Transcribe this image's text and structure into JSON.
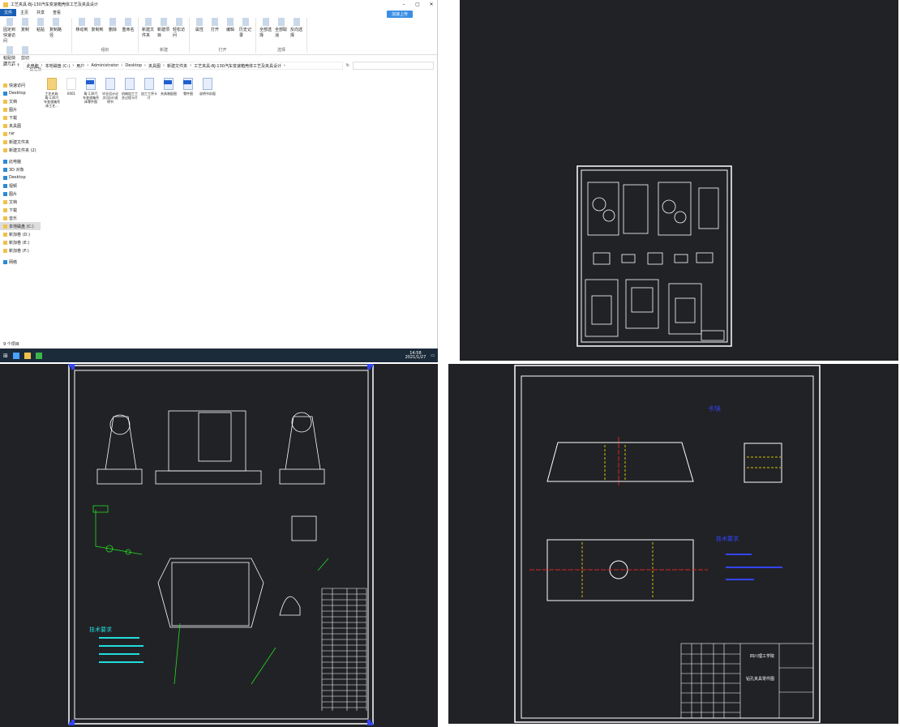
{
  "explorer": {
    "title": "工艺夹具-BJ-130汽车变速箱壳体工艺及夹具设计",
    "tabs": [
      "文件",
      "主页",
      "共享",
      "查看"
    ],
    "upload_label": "加速上传",
    "ribbon": [
      {
        "group": "剪贴板",
        "buttons": [
          "固定到快速访问",
          "复制",
          "粘贴",
          "复制路径",
          "粘贴快捷方式",
          "剪切"
        ]
      },
      {
        "group": "组织",
        "buttons": [
          "移动到",
          "复制到",
          "删除",
          "重命名"
        ]
      },
      {
        "group": "新建",
        "buttons": [
          "新建文件夹",
          "新建项目",
          "轻松访问"
        ]
      },
      {
        "group": "打开",
        "buttons": [
          "属性",
          "打开",
          "编辑",
          "历史记录"
        ]
      },
      {
        "group": "选择",
        "buttons": [
          "全部选择",
          "全部取消",
          "反向选择"
        ]
      }
    ],
    "breadcrumb": [
      "此电脑",
      "本地磁盘 (C:)",
      "用户",
      "Administrator",
      "Desktop",
      "夹具图",
      "新建文件夹",
      "工艺夹具-BJ-130汽车变速箱壳体工艺及夹具设计"
    ],
    "nav": [
      "快速访问",
      "Desktop",
      "文档",
      "图片",
      "下载",
      "夹具图",
      "rar",
      "新建文件夹",
      "新建文件夹 (2)",
      "此电脑",
      "3D 对象",
      "Desktop",
      "视频",
      "图片",
      "文档",
      "下载",
      "音乐",
      "本地磁盘 (C:)",
      "新加卷 (D:)",
      "新加卷 (E:)",
      "新加卷 (F:)",
      "网络"
    ],
    "files": [
      {
        "name": "工艺夹具-BJ-130汽车变速箱壳体工艺...",
        "type": "folder"
      },
      {
        "name": "0001",
        "type": "blank"
      },
      {
        "name": "BJ-130汽车变速箱壳体零件图",
        "type": "dwg"
      },
      {
        "name": "毕业设计论文(设计)说明书",
        "type": "doc"
      },
      {
        "name": "机械加工工艺过程卡片",
        "type": "doc"
      },
      {
        "name": "加工工序卡片",
        "type": "doc"
      },
      {
        "name": "夹具装配图",
        "type": "dwg"
      },
      {
        "name": "零件图",
        "type": "dwg"
      },
      {
        "name": "说明书封面",
        "type": "doc"
      }
    ],
    "status": "9 个项目"
  },
  "taskbar": {
    "time": "14:58",
    "date": "2021/1/27"
  },
  "cad": {
    "assembly_notes_title": "技术要求",
    "part_title": "卡块",
    "part_notes_title": "技术要求",
    "school": "四川理工学院",
    "drawing_name": "钻孔夹具零件图"
  },
  "colors": {
    "cad_bg": "#212226",
    "line": "#ffffff",
    "green": "#22dd22",
    "cyan": "#22dddd",
    "blue": "#3344ff",
    "ribbon_accent": "#1a5fb4"
  }
}
